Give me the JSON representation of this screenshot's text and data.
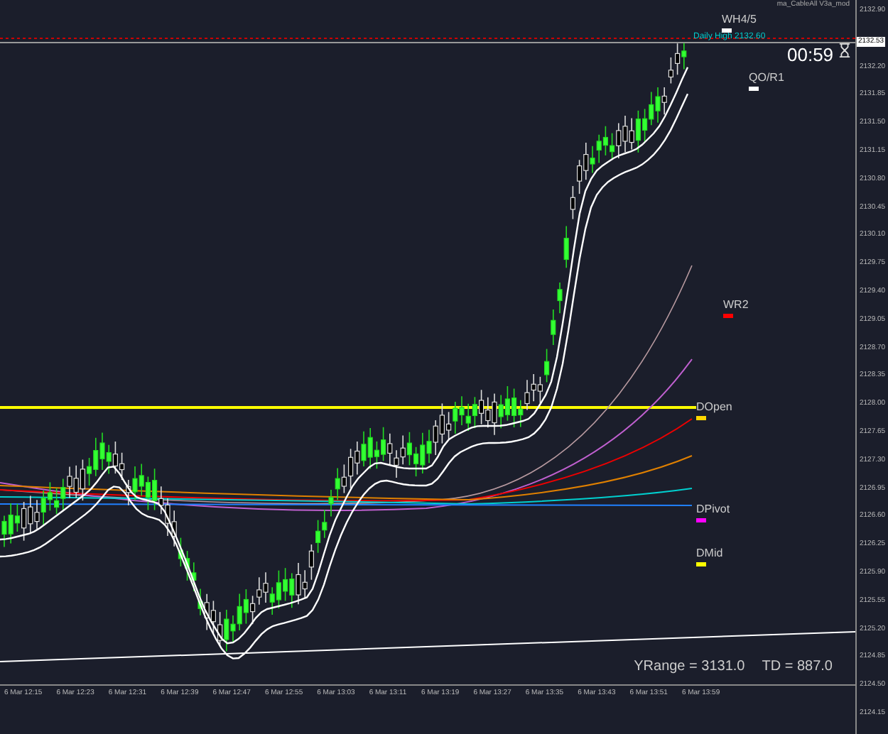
{
  "indicator_title": "ma_CableAll V3a_mod",
  "daily_high": "Daily High 2132.60",
  "countdown": "00:59",
  "current_price": "2132.53",
  "price_axis": [
    "2132.90",
    "2132.20",
    "2131.85",
    "2131.50",
    "2131.15",
    "2130.80",
    "2130.45",
    "2130.10",
    "2129.75",
    "2129.40",
    "2129.05",
    "2128.70",
    "2128.35",
    "2128.00",
    "2127.65",
    "2127.30",
    "2126.95",
    "2126.60",
    "2126.25",
    "2125.90",
    "2125.55",
    "2125.20",
    "2124.85",
    "2124.50",
    "2124.15"
  ],
  "time_axis": [
    "6 Mar 12:15",
    "6 Mar 12:23",
    "6 Mar 12:31",
    "6 Mar 12:39",
    "6 Mar 12:47",
    "6 Mar 12:55",
    "6 Mar 13:03",
    "6 Mar 13:11",
    "6 Mar 13:19",
    "6 Mar 13:27",
    "6 Mar 13:35",
    "6 Mar 13:43",
    "6 Mar 13:51",
    "6 Mar 13:59"
  ],
  "levels": [
    {
      "label": "WH4/5",
      "color": "#ffffff"
    },
    {
      "label": "QO/R1",
      "color": "#ffffff"
    },
    {
      "label": "WR2",
      "color": "#ff0000"
    },
    {
      "label": "DOpen",
      "color": "#ffd700"
    },
    {
      "label": "DPivot",
      "color": "#ff00ff"
    },
    {
      "label": "DMid",
      "color": "#ffff00"
    }
  ],
  "stats": [
    "YRange = 3131.0",
    "TD = 887.0"
  ]
}
